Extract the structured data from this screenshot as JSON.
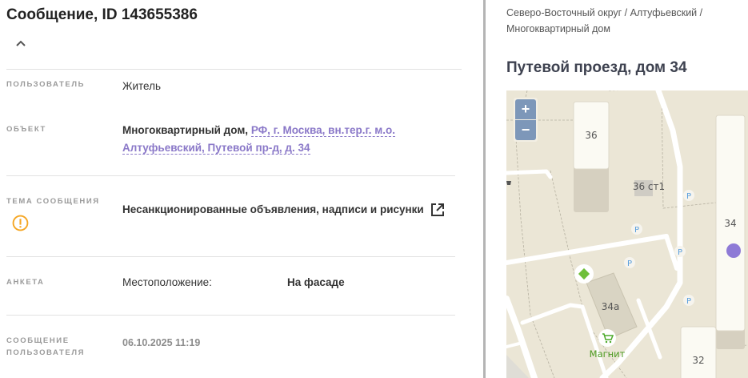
{
  "header": {
    "title": "Сообщение, ID 143655386"
  },
  "fields": {
    "user": {
      "label": "Пользователь",
      "value": "Житель"
    },
    "object": {
      "label": "Объект",
      "type": "Многоквартирный дом,",
      "address_line1": "РФ, г. Москва, вн.тер.г. м.о.",
      "address_line2": "Алтуфьевский, Путевой пр-д, д. 34"
    },
    "topic": {
      "label": "Тема сообщения",
      "value": "Несанкционированные объявления, надписи и рисунки",
      "icon": "warning-circle-icon",
      "icon_color": "#f5a623"
    },
    "survey": {
      "label": "Анкета",
      "question": "Местоположение:",
      "answer": "На фасаде"
    },
    "message": {
      "label_line1": "Сообщение",
      "label_line2": "пользователя",
      "value": "06.10.2025 11:19"
    }
  },
  "right": {
    "breadcrumb_line1": "Северо-Восточный округ / Алтуфьевский /",
    "breadcrumb_line2": "Многоквартирный дом",
    "address": "Путевой проезд, дом 34"
  },
  "map": {
    "zoom_in": "+",
    "zoom_out": "−",
    "buildings": [
      "36",
      "36 ст1",
      "34",
      "34а",
      "32"
    ],
    "poi": "Магнит",
    "parking": "P",
    "marker_color": "#8e7ad6"
  },
  "colors": {
    "link": "#8a78c8",
    "accent": "#f5a623"
  }
}
